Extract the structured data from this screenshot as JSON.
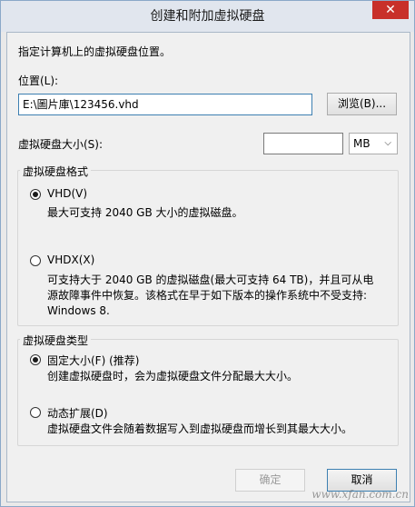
{
  "window": {
    "title": "创建和附加虚拟硬盘",
    "close_glyph": "✕"
  },
  "intro": "指定计算机上的虚拟硬盘位置。",
  "location": {
    "label": "位置(L):",
    "value": "E:\\圖片庫\\123456.vhd",
    "browse_label": "浏览(B)..."
  },
  "size": {
    "label": "虚拟硬盘大小(S):",
    "value": "",
    "unit": "MB",
    "unit_chevron": "⌵"
  },
  "format_group": {
    "title": "虚拟硬盘格式",
    "options": [
      {
        "label": "VHD(V)",
        "checked": true,
        "description": "最大可支持 2040 GB 大小的虚拟磁盘。"
      },
      {
        "label": "VHDX(X)",
        "checked": false,
        "description": "可支持大于 2040 GB 的虚拟磁盘(最大可支持 64 TB)，并且可从电源故障事件中恢复。该格式在早于如下版本的操作系统中不受支持: Windows 8."
      }
    ]
  },
  "type_group": {
    "title": "虚拟硬盘类型",
    "options": [
      {
        "label": "固定大小(F) (推荐)",
        "checked": true,
        "description": "创建虚拟硬盘时，会为虚拟硬盘文件分配最大大小。"
      },
      {
        "label": "动态扩展(D)",
        "checked": false,
        "description": "虚拟硬盘文件会随着数据写入到虚拟硬盘而增长到其最大大小。"
      }
    ]
  },
  "buttons": {
    "ok": "确定",
    "cancel": "取消"
  },
  "watermark": "www.xfan.com.cn"
}
